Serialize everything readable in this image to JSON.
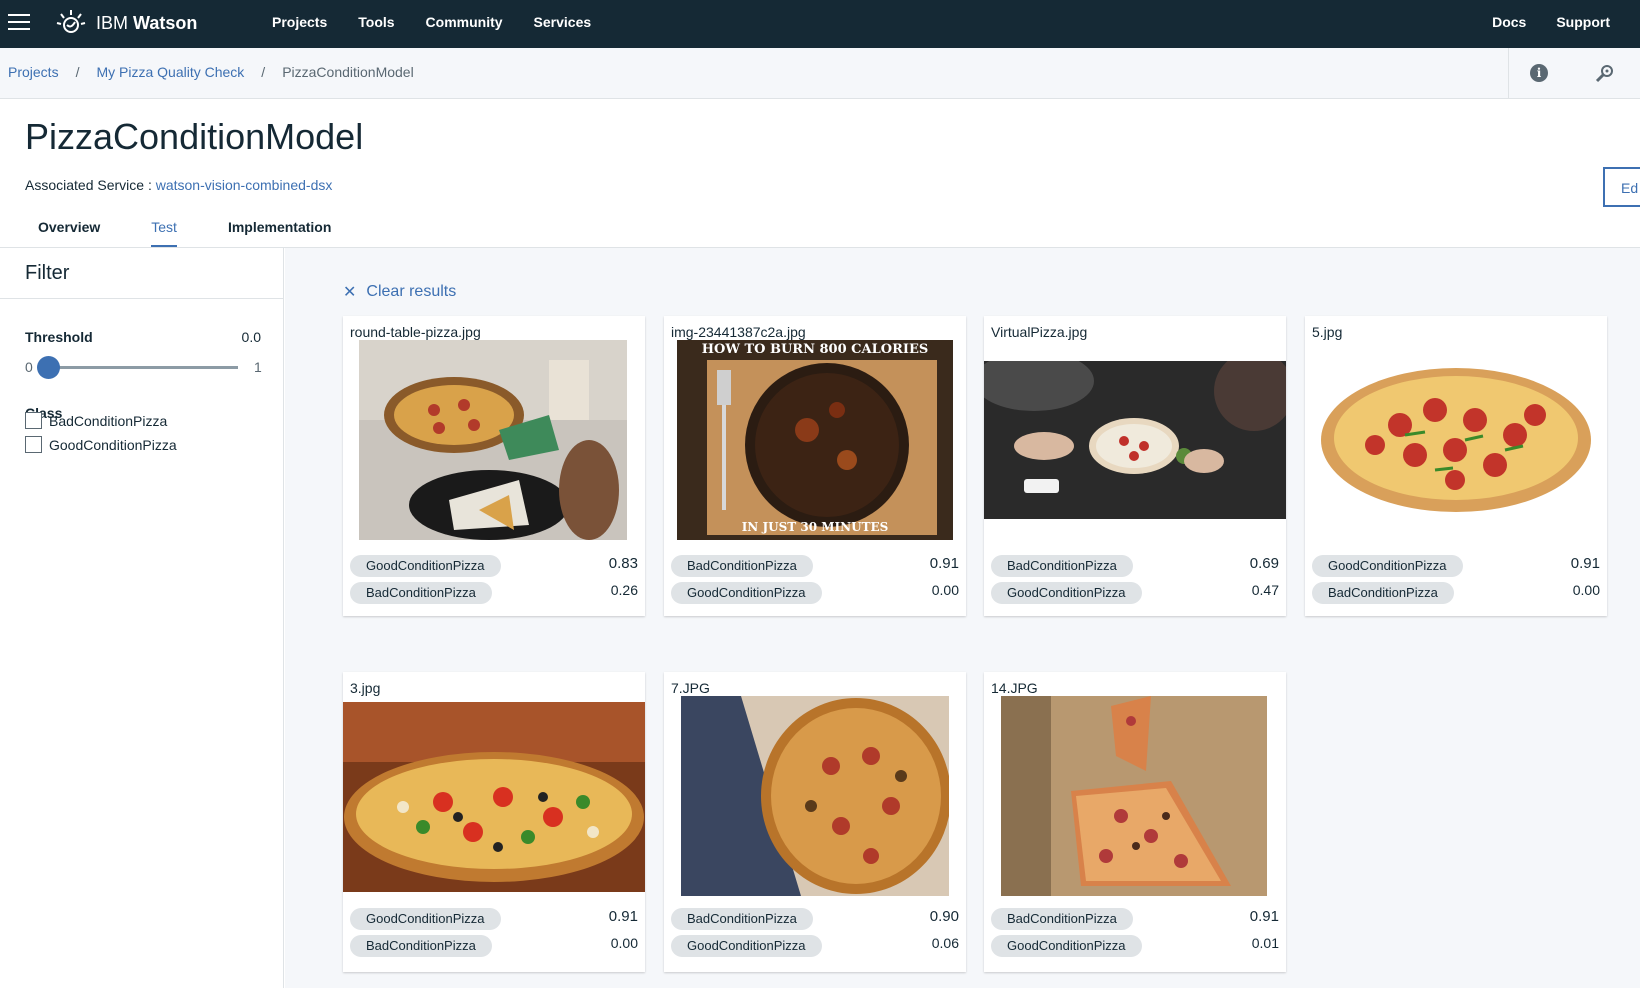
{
  "topnav": {
    "brand_light": "IBM ",
    "brand_bold": "Watson",
    "links": [
      "Projects",
      "Tools",
      "Community",
      "Services"
    ],
    "right_links": [
      "Docs",
      "Support"
    ]
  },
  "breadcrumb": {
    "items": [
      "Projects",
      "My Pizza Quality Check"
    ],
    "current": "PizzaConditionModel",
    "separator": "/"
  },
  "header": {
    "title": "PizzaConditionModel",
    "assoc_label": "Associated Service : ",
    "assoc_link": "watson-vision-combined-dsx",
    "edit_label": "Ed",
    "tabs": [
      "Overview",
      "Test",
      "Implementation"
    ],
    "active_tab": "Test"
  },
  "filter": {
    "title": "Filter",
    "threshold_label": "Threshold",
    "threshold_value": "0.0",
    "slider_min": "0",
    "slider_max": "1",
    "class_label": "Class",
    "classes": [
      "BadConditionPizza",
      "GoodConditionPizza"
    ]
  },
  "results": {
    "clear_label": "Clear results",
    "cards": [
      {
        "file": "round-table-pizza.jpg",
        "tag1": "GoodConditionPizza",
        "score1": "0.83",
        "tag2": "BadConditionPizza",
        "score2": "0.26"
      },
      {
        "file": "img-23441387c2a.jpg",
        "tag1": "BadConditionPizza",
        "score1": "0.91",
        "tag2": "GoodConditionPizza",
        "score2": "0.00",
        "img_text_top": "HOW TO BURN 800 CALORIES",
        "img_text_bottom": "IN JUST 30 MINUTES"
      },
      {
        "file": "VirtualPizza.jpg",
        "tag1": "BadConditionPizza",
        "score1": "0.69",
        "tag2": "GoodConditionPizza",
        "score2": "0.47"
      },
      {
        "file": "5.jpg",
        "tag1": "GoodConditionPizza",
        "score1": "0.91",
        "tag2": "BadConditionPizza",
        "score2": "0.00"
      },
      {
        "file": "3.jpg",
        "tag1": "GoodConditionPizza",
        "score1": "0.91",
        "tag2": "BadConditionPizza",
        "score2": "0.00"
      },
      {
        "file": "7.JPG",
        "tag1": "BadConditionPizza",
        "score1": "0.90",
        "tag2": "GoodConditionPizza",
        "score2": "0.06"
      },
      {
        "file": "14.JPG",
        "tag1": "BadConditionPizza",
        "score1": "0.91",
        "tag2": "GoodConditionPizza",
        "score2": "0.01"
      }
    ]
  },
  "colors": {
    "nav_bg": "#152935",
    "link": "#3d70b2",
    "tag_bg": "#dfe3e6",
    "main_bg": "#f5f7fa"
  }
}
